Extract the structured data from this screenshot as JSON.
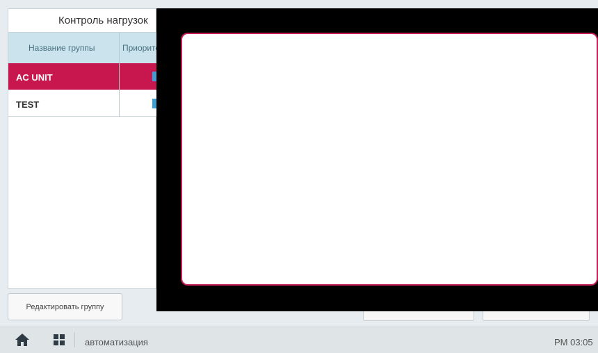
{
  "tab": {
    "label": "Контроль нагрузок"
  },
  "table": {
    "headers": {
      "name": "Название группы",
      "priority": "Приоритет"
    },
    "rows": [
      {
        "name": "AC UNIT",
        "selected": true
      },
      {
        "name": "TEST",
        "selected": false
      }
    ]
  },
  "actions": {
    "edit_group_label": "Редактировать группу"
  },
  "colors": {
    "accent": "#c8174e",
    "priority": "#3f9fd3",
    "header_bg": "#cbe3ec"
  },
  "bottombar": {
    "home_icon": "home-icon",
    "apps_icon": "grid-icon",
    "breadcrumb": "автоматизация",
    "clock": "PM 03:05"
  }
}
